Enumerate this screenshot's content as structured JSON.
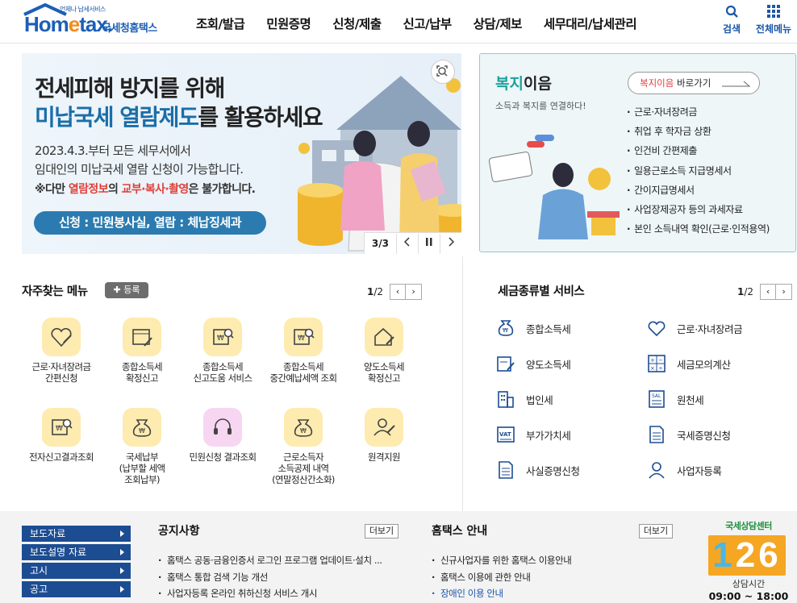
{
  "header": {
    "logo_tag": "언제나 납세서비스",
    "logo_text_a": "Hom",
    "logo_text_e": "e",
    "logo_text_b": "tax.",
    "logo_korean": "국세청홈택스",
    "nav": [
      "조회/발급",
      "민원증명",
      "신청/제출",
      "신고/납부",
      "상담/제보",
      "세무대리/납세관리"
    ],
    "search_label": "검색",
    "menu_label": "전체메뉴"
  },
  "banner": {
    "line1": "전세피해 방지를 위해",
    "line2_blue": "미납국세 열람제도",
    "line2_black": "를 활용하세요",
    "desc1": "2023.4.3.부터 모든 세무서에서",
    "desc2": "임대인의 미납국세 열람 신청이 가능합니다.",
    "note_a": "※다만 ",
    "note_red1": "열람정보",
    "note_b": "의 ",
    "note_red2": "교부·복사·촬영",
    "note_c": "은 불가합니다.",
    "pill": "신청 : 민원봉사실, 열람 : 체납징세과",
    "page": "3/3"
  },
  "welfare": {
    "title_a": "복지",
    "title_b": "이음",
    "subtitle": "소득과 복지를 연결하다!",
    "button_a": "복지이음",
    "button_b": " 바로가기",
    "items": [
      "근로·자녀장려금",
      "취업 후 학자금 상환",
      "인건비 간편제출",
      "일용근로소득 지급명세서",
      "간이지급명세서",
      "사업장제공자 등의 과세자료",
      "본인 소득내역 확인(근로·인적용역)"
    ]
  },
  "favorites": {
    "title": "자주찾는 메뉴",
    "add": "등록",
    "page_cur": "1",
    "page_total": "/2",
    "items": [
      [
        "근로·자녀장려금",
        "간편신청",
        ""
      ],
      [
        "종합소득세",
        "확정신고",
        ""
      ],
      [
        "종합소득세",
        "신고도움 서비스",
        ""
      ],
      [
        "종합소득세",
        "중간예납세액 조회",
        ""
      ],
      [
        "양도소득세",
        "확정신고",
        ""
      ],
      [
        "전자신고결과조회",
        "",
        ""
      ],
      [
        "국세납부",
        "(납부할 세액",
        "조회납부)"
      ],
      [
        "민원신청 결과조회",
        "",
        ""
      ],
      [
        "근로소득자",
        "소득공제 내역",
        "(연말정산간소화)"
      ],
      [
        "원격지원",
        "",
        ""
      ]
    ]
  },
  "taxservice": {
    "title": "세금종류별 서비스",
    "page_cur": "1",
    "page_total": "/2",
    "items": [
      "종합소득세",
      "근로·자녀장려금",
      "양도소득세",
      "세금모의계산",
      "법인세",
      "원천세",
      "부가가치세",
      "국세증명신청",
      "사실증명신청",
      "사업자등록"
    ]
  },
  "footer": {
    "quick": [
      "보도자료",
      "보도설명 자료",
      "고시",
      "공고"
    ],
    "notice_title": "공지사항",
    "notice_more": "더보기",
    "notices": [
      "홈택스 공동·금융인증서 로그인 프로그램 업데이트·설치 ...",
      "홈택스 통합 검색 기능 개선",
      "사업자등록 온라인 취하신청 서비스 개시"
    ],
    "guide_title": "홈택스 안내",
    "guide_more": "더보기",
    "guides": [
      "신규사업자를 위한 홈택스 이용안내",
      "홈택스 이용에 관한 안내",
      "장애인 이용 안내"
    ],
    "center_title": "국세상담센터",
    "center_num_a": "1",
    "center_num_b": "26",
    "center_sub": "상담시간",
    "center_hours": "09:00 ~ 18:00"
  }
}
